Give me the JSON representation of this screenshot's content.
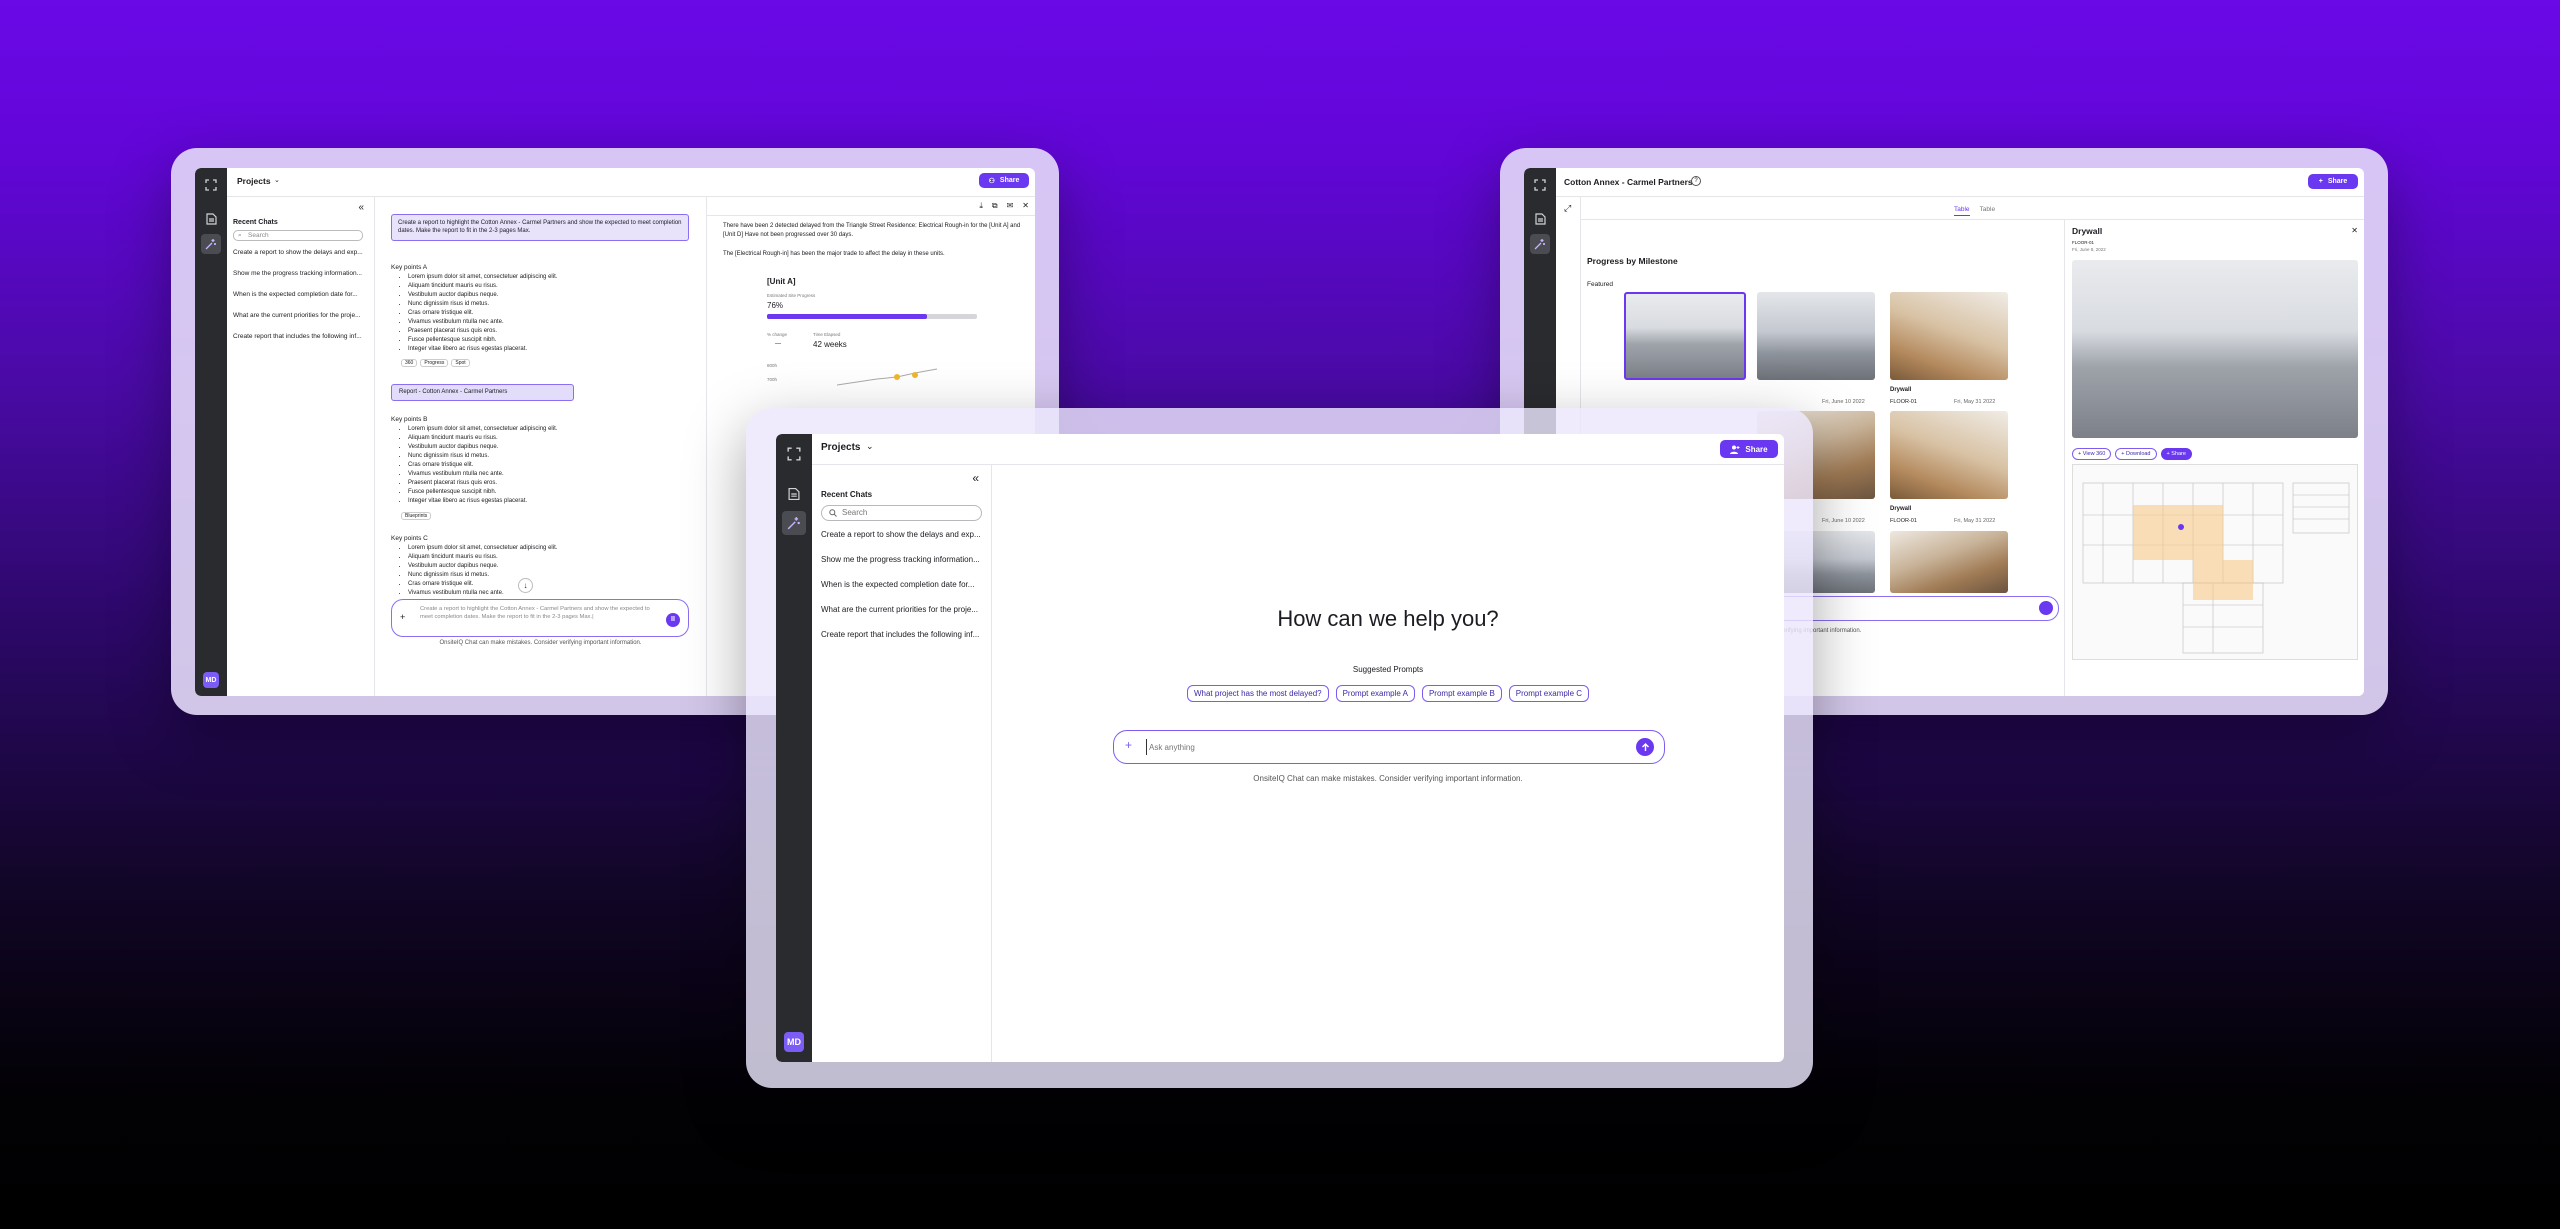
{
  "brand": {
    "accent": "#6a38f0",
    "rail": "#2a2b2e",
    "background_top": "#6a08e6",
    "background_bottom": "#000000"
  },
  "icons": {
    "expand": "expand-icon",
    "docs": "document-icon",
    "sparkle": "sparkle-icon",
    "collapse": "double-chevron-left-icon",
    "search": "search-icon",
    "plus": "plus-icon",
    "send": "arrow-up-icon",
    "share": "share-user-icon",
    "help": "help-circle-icon",
    "close": "close-icon",
    "download": "download-icon",
    "copy": "copy-icon",
    "mail": "mail-icon",
    "pause": "pause-icon",
    "scroll_down": "arrow-down-icon"
  },
  "center": {
    "header": {
      "title": "Projects",
      "share": "Share"
    },
    "recent_title": "Recent Chats",
    "search_placeholder": "Search",
    "chats": [
      "Create a report to show the delays and exp...",
      "Show me the progress tracking information...",
      "When is the expected completion date for...",
      "What are the current priorities for the proje...",
      "Create report that includes the following inf..."
    ],
    "heading": "How can we help you?",
    "suggested_title": "Suggested Prompts",
    "prompts": [
      "What project has the most delayed?",
      "Prompt example A",
      "Prompt example B",
      "Prompt example C"
    ],
    "input_placeholder": "Ask anything",
    "disclaimer": "OnsiteIQ Chat can make mistakes. Consider verifying important information.",
    "avatar": "MD"
  },
  "left": {
    "header": {
      "title": "Projects",
      "share": "Share"
    },
    "recent_title": "Recent Chats",
    "search_placeholder": "Search",
    "chats": [
      "Create a report to show the delays and exp...",
      "Show me the progress tracking information...",
      "When is the expected completion date for...",
      "What are the current priorities for the proje...",
      "Create report that includes the following inf..."
    ],
    "user_message": "Create a report to highlight the Cotton Annex - Carmel Partners and show the expected to meet completion dates. Make the report to fit in the 2-3 pages Max.",
    "sections": [
      {
        "title": "Key points A",
        "items": [
          "Lorem ipsum dolor sit amet, consectetuer adipiscing elit.",
          "Aliquam tincidunt mauris eu risus.",
          "Vestibulum auctor dapibus neque.",
          "Nunc dignissim risus id metus.",
          "Cras ornare tristique elit.",
          "Vivamus vestibulum ntulla nec ante.",
          "Praesent placerat risus quis eros.",
          "Fusce pellentesque suscipit nibh.",
          "Integer vitae libero ac risus egestas placerat."
        ],
        "tags": [
          "360",
          "Progress",
          "Spot"
        ]
      },
      {
        "title": "Key points B",
        "items": [
          "Lorem ipsum dolor sit amet, consectetuer adipiscing elit.",
          "Aliquam tincidunt mauris eu risus.",
          "Vestibulum auctor dapibus neque.",
          "Nunc dignissim risus id metus.",
          "Cras ornare tristique elit.",
          "Vivamus vestibulum ntulla nec ante.",
          "Praesent placerat risus quis eros.",
          "Fusce pellentesque suscipit nibh.",
          "Integer vitae libero ac risus egestas placerat."
        ],
        "tags": [
          "Blueprints"
        ]
      },
      {
        "title": "Key points C",
        "items": [
          "Lorem ipsum dolor sit amet, consectetuer adipiscing elit.",
          "Aliquam tincidunt mauris eu risus.",
          "Vestibulum auctor dapibus neque.",
          "Nunc dignissim risus id metus.",
          "Cras ornare tristique elit.",
          "Vivamus vestibulum ntulla nec ante."
        ],
        "tags": []
      }
    ],
    "report_chip": "Report - Cotton Annex - Carmel Partners",
    "composer_text": "Create a report to highlight the Cotton Annex - Carmel Partners and show the expected to meet completion dates. Make the report to fit in the 2-3 pages Max.|",
    "disclaimer": "OnsiteIQ Chat can make mistakes. Consider verifying important information.",
    "report_p1": "There have been 2 detected delayed from the Triangle Street Residence: Electrical Rough-in for the [Unit A] and [Unit D] Have not been progressed over 30 days.",
    "report_p2": "The [Electrical Rough-in] has been the major trade to affect the delay in these units.",
    "unit": "[Unit A]",
    "progress_label": "Estimated Site Progress",
    "progress_value": "76%",
    "progress_fraction": 0.76,
    "stat1_label": "% change",
    "stat1_value": "—",
    "stat2_label": "Time Elapsed",
    "stat2_value": "42 weeks",
    "mini_axis": [
      "800h",
      "700h"
    ],
    "avatar": "MD"
  },
  "right": {
    "title": "Cotton Annex - Carmel Partners",
    "share": "Share",
    "tabs": [
      "Table",
      "Table"
    ],
    "section_title": "Progress by Milestone",
    "featured": "Featured",
    "cards": [
      {
        "title": "",
        "floor": "",
        "date": ""
      },
      {
        "title": "",
        "floor": "",
        "date": "Fri, June 10 2022"
      },
      {
        "title": "Drywall",
        "floor": "FLOOR-01",
        "date": "Fri, May 31 2022"
      },
      {
        "title": "",
        "floor": "",
        "date": "Fri, June 10 2022"
      },
      {
        "title": "Drywall",
        "floor": "FLOOR-01",
        "date": "Fri, May 31 2022"
      }
    ],
    "disclaimer": "onsider verifying important information.",
    "panel": {
      "title": "Drywall",
      "floor": "FLOOR-01",
      "date": "Fri, June 8, 2022",
      "view360": "View 360",
      "download": "Download",
      "share": "Share"
    }
  }
}
